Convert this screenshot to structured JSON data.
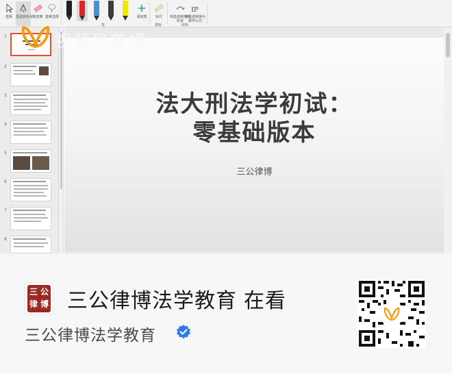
{
  "ribbon": {
    "tools": [
      {
        "label": "选择",
        "icon": "cursor-icon"
      },
      {
        "label": "墨迹转形状",
        "icon": "ink-to-shape-icon"
      },
      {
        "label": "橡皮擦",
        "icon": "eraser-icon"
      },
      {
        "label": "套索选择",
        "icon": "lasso-icon"
      }
    ],
    "pens": [
      {
        "color": "#1f1f1f"
      },
      {
        "color": "#d62828"
      },
      {
        "color": "#4a90d9"
      },
      {
        "color": "#3c3c3c"
      },
      {
        "color": "#f2e600"
      }
    ],
    "add_pen_label": "添加笔",
    "ruler_label": "标尺",
    "ink_to_shape_label": "将墨迹转换为形状",
    "ink_to_math_label": "将墨迹转换为数学公式",
    "group_pens": "笔",
    "group_stencils": "模板",
    "group_convert": "转换"
  },
  "thumbnails": [
    {
      "number": "1",
      "selected": true
    },
    {
      "number": "2"
    },
    {
      "number": "3"
    },
    {
      "number": "4"
    },
    {
      "number": "5"
    },
    {
      "number": "6"
    },
    {
      "number": "7"
    },
    {
      "number": "8"
    }
  ],
  "slide": {
    "title": "法大刑法学初试：\n零基础版本",
    "subtitle": "三公律博"
  },
  "watermark": {
    "text": "视频号首播"
  },
  "footer": {
    "account_title": "三公律博法学教育",
    "status": "在看",
    "account_name": "三公律博法学教育",
    "avatar_chars": [
      "三",
      "公",
      "律",
      "博"
    ],
    "verified_color": "#2b7ce9"
  }
}
